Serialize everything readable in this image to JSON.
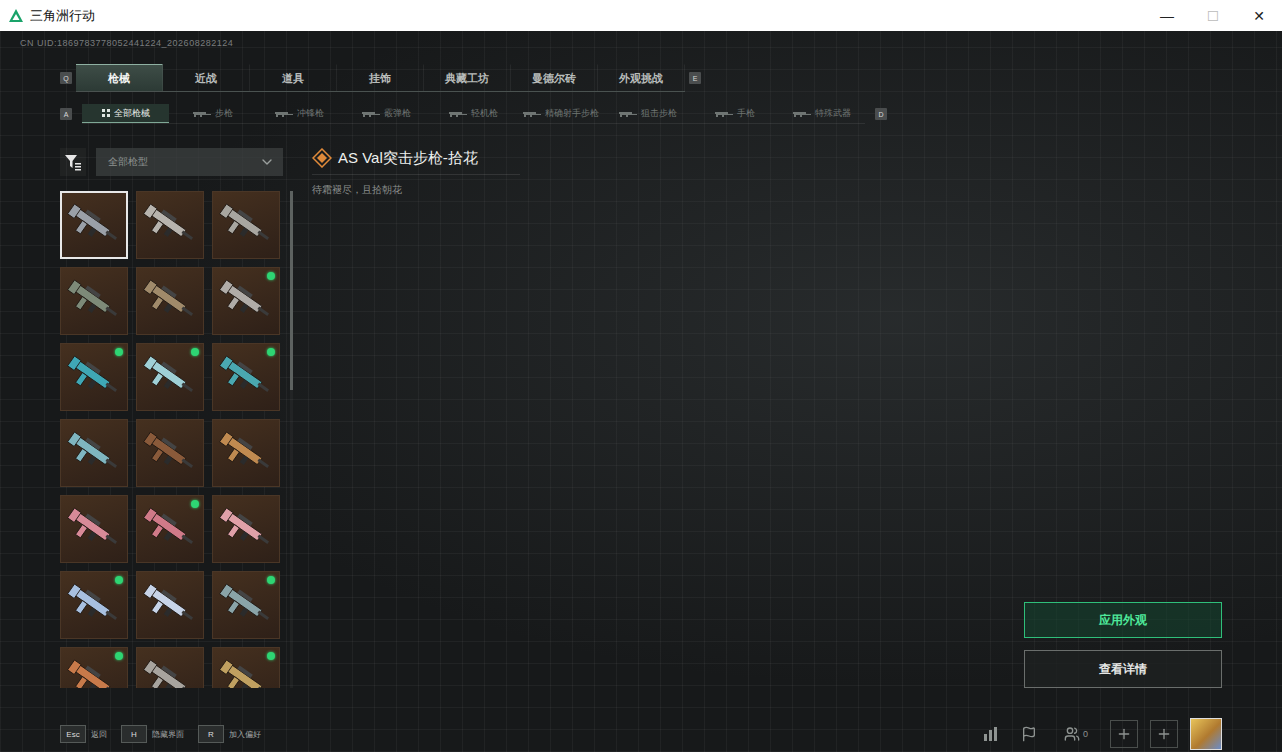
{
  "window": {
    "title": "三角洲行动",
    "controls": [
      {
        "glyph": "—",
        "disabled": false
      },
      {
        "glyph": "☐",
        "disabled": true
      },
      {
        "glyph": "✕",
        "disabled": false
      }
    ]
  },
  "uid": "CN UID:1869783778052441224_202608282124",
  "tabs": {
    "prev_key": "Q",
    "next_key": "E",
    "items": [
      {
        "label": "枪械",
        "selected": true
      },
      {
        "label": "近战",
        "selected": false
      },
      {
        "label": "道具",
        "selected": false
      },
      {
        "label": "挂饰",
        "selected": false
      },
      {
        "label": "典藏工坊",
        "selected": false
      },
      {
        "label": "曼德尔砖",
        "selected": false
      },
      {
        "label": "外观挑战",
        "selected": false
      }
    ]
  },
  "subtabs": {
    "prev_key": "A",
    "next_key": "D",
    "items": [
      {
        "label": "全部枪械",
        "selected": true
      },
      {
        "label": "步枪",
        "selected": false
      },
      {
        "label": "冲锋枪",
        "selected": false
      },
      {
        "label": "霰弹枪",
        "selected": false
      },
      {
        "label": "轻机枪",
        "selected": false
      },
      {
        "label": "精确射手步枪",
        "selected": false
      },
      {
        "label": "狙击步枪",
        "selected": false
      },
      {
        "label": "手枪",
        "selected": false
      },
      {
        "label": "特殊武器",
        "selected": false
      }
    ]
  },
  "filter": {
    "value": "全部枪型"
  },
  "scrollbar": {
    "level": 0.4
  },
  "weapons": [
    {
      "color": "#9aa0a8",
      "marked": false,
      "selected": true
    },
    {
      "color": "#b8b4ae",
      "marked": false,
      "selected": false
    },
    {
      "color": "#a8a6a0",
      "marked": false,
      "selected": false
    },
    {
      "color": "#7d8a78",
      "marked": false,
      "selected": false
    },
    {
      "color": "#a08a6a",
      "marked": false,
      "selected": false
    },
    {
      "color": "#b0aca8",
      "marked": true,
      "selected": false
    },
    {
      "color": "#3fa7b5",
      "marked": true,
      "selected": false
    },
    {
      "color": "#9fd0d6",
      "marked": true,
      "selected": false
    },
    {
      "color": "#4aa8b0",
      "marked": true,
      "selected": false
    },
    {
      "color": "#7fb6c0",
      "marked": false,
      "selected": false
    },
    {
      "color": "#8a5a3a",
      "marked": false,
      "selected": false
    },
    {
      "color": "#c08a50",
      "marked": false,
      "selected": false
    },
    {
      "color": "#d88a98",
      "marked": false,
      "selected": false
    },
    {
      "color": "#d07a88",
      "marked": true,
      "selected": false
    },
    {
      "color": "#e0a0a8",
      "marked": false,
      "selected": false
    },
    {
      "color": "#a8c0e0",
      "marked": true,
      "selected": false
    },
    {
      "color": "#c8d4e8",
      "marked": false,
      "selected": false
    },
    {
      "color": "#8aa4a8",
      "marked": true,
      "selected": false
    },
    {
      "color": "#c87a4a",
      "marked": true,
      "selected": false
    },
    {
      "color": "#a8a49e",
      "marked": false,
      "selected": false
    },
    {
      "color": "#c0a060",
      "marked": true,
      "selected": false
    }
  ],
  "detail": {
    "title": "AS Val突击步枪-拾花",
    "subtitle": "待霜褪尽，且拾朝花"
  },
  "actions": [
    {
      "label": "应用外观",
      "primary": true
    },
    {
      "label": "查看详情",
      "primary": false
    }
  ],
  "hints": [
    {
      "key": "Esc",
      "label": "返回"
    },
    {
      "key": "H",
      "label": "隐藏界面"
    },
    {
      "key": "R",
      "label": "加入偏好"
    }
  ],
  "friends_count": "0"
}
